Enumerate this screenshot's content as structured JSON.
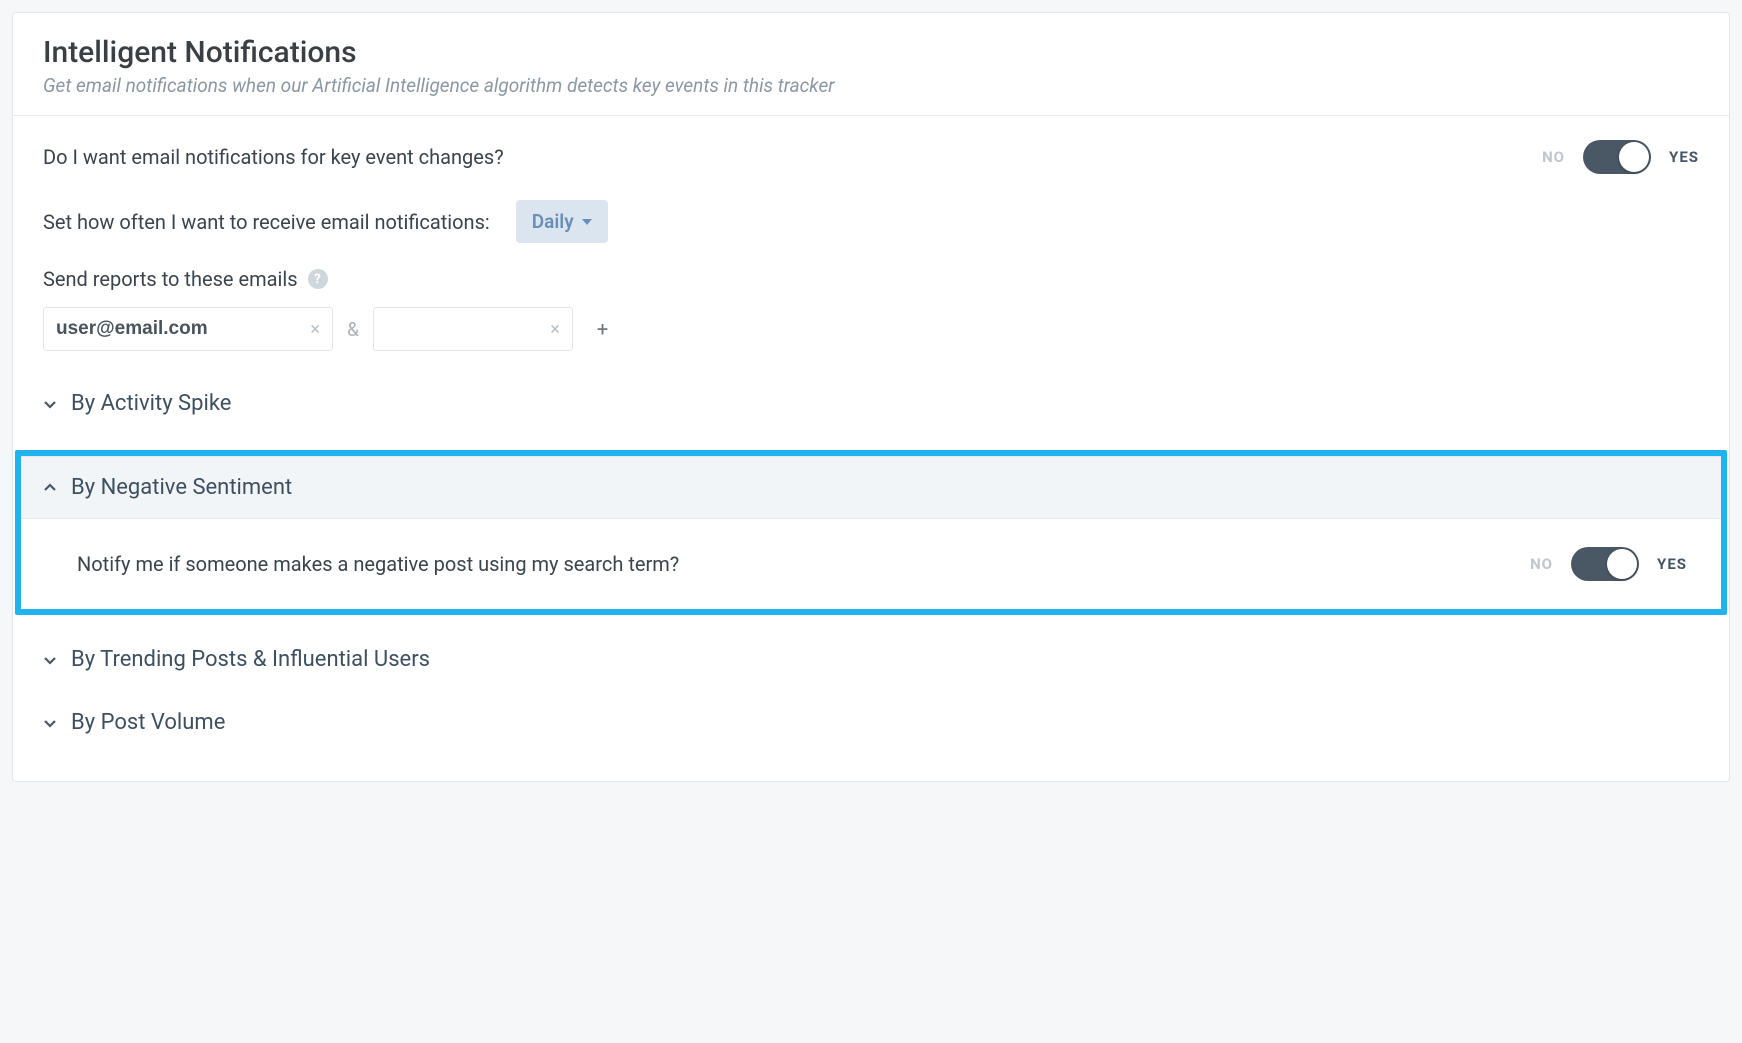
{
  "header": {
    "title": "Intelligent Notifications",
    "subtitle": "Get email notifications when our Artificial Intelligence algorithm detects key events in this tracker"
  },
  "main": {
    "enable_label": "Do I want email notifications for key event changes?",
    "enable_toggle": {
      "no": "NO",
      "yes": "YES"
    },
    "frequency_label": "Set how often I want to receive email notifications:",
    "frequency_value": "Daily",
    "emails_label": "Send reports to these emails",
    "emails": {
      "first": "user@email.com",
      "second": "",
      "amp": "&",
      "add": "+"
    }
  },
  "sections": {
    "activity_spike": {
      "title": "By Activity Spike"
    },
    "negative_sentiment": {
      "title": "By Negative Sentiment",
      "notify_label": "Notify me if someone makes a negative post using my search term?",
      "toggle": {
        "no": "NO",
        "yes": "YES"
      }
    },
    "trending": {
      "title": "By Trending Posts & Influential Users"
    },
    "post_volume": {
      "title": "By Post Volume"
    }
  }
}
